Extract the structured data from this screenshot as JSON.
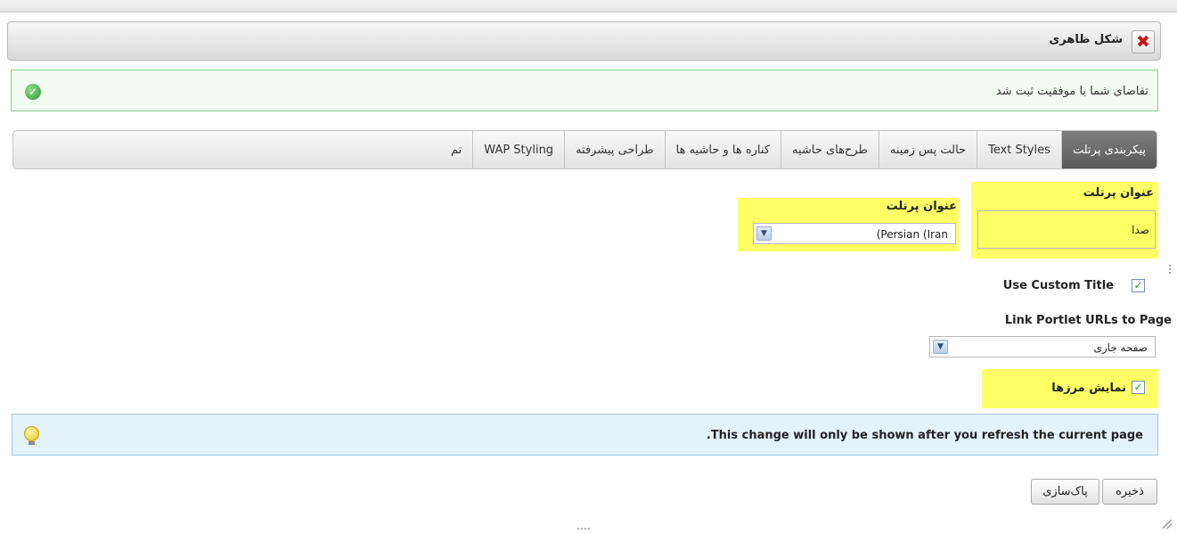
{
  "window": {
    "title": "شکل ظاهری"
  },
  "success_message": "تقاضای شما با موفقیت ثبت شد",
  "tabs": [
    {
      "label": "پیکربندی پرتلت",
      "active": true
    },
    {
      "label": "Text Styles"
    },
    {
      "label": "حالت پس زمینه"
    },
    {
      "label": "طرح‌های حاشیه"
    },
    {
      "label": "کناره ها و حاشیه ها"
    },
    {
      "label": "طراحی پیشرفته"
    },
    {
      "label": "WAP Styling"
    },
    {
      "label": "تم"
    }
  ],
  "form": {
    "portlet_title_label": "عنوان پرتلت",
    "portlet_title_value": "صدا",
    "language_label": "عنوان پرتلت",
    "language_value": "(Persian (Iran",
    "use_custom_title_label": "Use Custom Title",
    "use_custom_title_checked": true,
    "link_urls_label": "Link Portlet URLs to Page",
    "link_urls_value": "صفحه جاری",
    "show_borders_label": "نمایش مرزها",
    "show_borders_checked": true
  },
  "info_message": ".This change will only be shown after you refresh the current page",
  "buttons": {
    "save": "ذخیره",
    "reset": "پاک‌سازی"
  },
  "colors": {
    "highlight": "#ffff66",
    "success_bg": "#f2fbf0",
    "info_bg": "#e4f2fc",
    "active_tab": "#6b6b6b"
  }
}
